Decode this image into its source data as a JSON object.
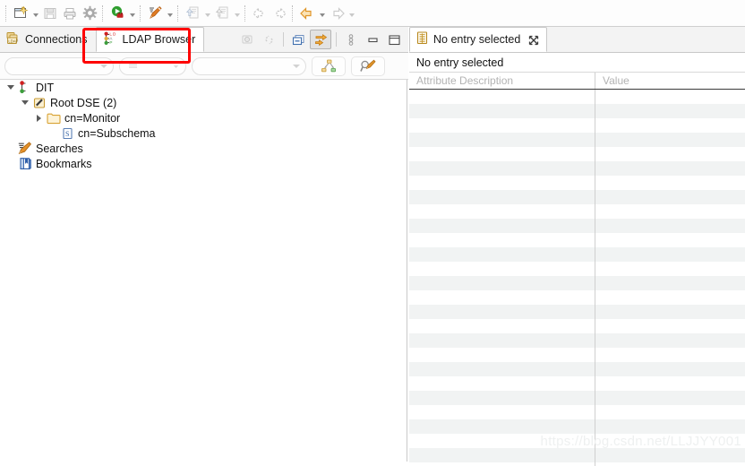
{
  "toolbar": {
    "buttons": [
      {
        "name": "new-wizard-button",
        "icon": "new-document-icon",
        "dropdown": true,
        "enabled": true
      },
      {
        "name": "save-button",
        "icon": "save-floppy-icon",
        "dropdown": false,
        "enabled": false
      },
      {
        "name": "print-button",
        "icon": "printer-icon",
        "dropdown": false,
        "enabled": false
      },
      {
        "name": "preferences-button",
        "icon": "gear-icon",
        "dropdown": false,
        "enabled": true
      },
      {
        "name": "run-connection-button",
        "icon": "green-play-icon",
        "dropdown": true,
        "enabled": true
      },
      {
        "name": "new-search-button",
        "icon": "pencil-search-icon",
        "dropdown": true,
        "enabled": true
      },
      {
        "name": "import-button",
        "icon": "import-arrow-icon",
        "dropdown": true,
        "enabled": false
      },
      {
        "name": "export-button",
        "icon": "export-arrow-icon",
        "dropdown": true,
        "enabled": false
      },
      {
        "name": "back-nav-button",
        "icon": "left-arrow-icon",
        "dropdown": false,
        "enabled": false
      },
      {
        "name": "forward-nav-button",
        "icon": "right-arrow-icon",
        "dropdown": false,
        "enabled": false
      },
      {
        "name": "history-back-button",
        "icon": "orange-left-arrow-icon",
        "dropdown": true,
        "enabled": true
      },
      {
        "name": "history-forward-button",
        "icon": "grey-right-arrow-icon",
        "dropdown": true,
        "enabled": false
      }
    ]
  },
  "left_view": {
    "tabs": [
      {
        "label": "Connections",
        "icon": "ldap-connections-icon",
        "active": false
      },
      {
        "label": "LDAP Browser",
        "icon": "ldap-browser-icon",
        "active": true
      }
    ],
    "tab_tools": [
      {
        "name": "refresh-view-button",
        "icon": "refresh-entry-icon",
        "enabled": false,
        "pressed": false
      },
      {
        "name": "link-with-editor-button",
        "icon": "link-chain-icon",
        "enabled": false,
        "pressed": false
      },
      {
        "name": "collapse-all-button",
        "icon": "collapse-all-icon",
        "enabled": true,
        "pressed": false
      },
      {
        "name": "toggle-quick-filter-button",
        "icon": "orange-double-arrow-icon",
        "enabled": true,
        "pressed": true
      },
      {
        "name": "view-menu-button",
        "icon": "vertical-dots-icon",
        "enabled": true,
        "pressed": false
      },
      {
        "name": "minimize-view-button",
        "icon": "minimize-icon",
        "enabled": true,
        "pressed": false
      },
      {
        "name": "maximize-view-button",
        "icon": "maximize-icon",
        "enabled": true,
        "pressed": false
      }
    ],
    "filter_row": {
      "attribute_combo_value": "",
      "operator_spinner_value": "",
      "value_combo_value": "",
      "buttons": [
        {
          "name": "filter-children-button",
          "icon": "node-graph-icon"
        },
        {
          "name": "quick-search-button",
          "icon": "magnifier-pencil-icon"
        }
      ]
    },
    "tree": [
      {
        "label": "DIT",
        "icon": "dit-root-icon",
        "indent": 0,
        "twisty": "open"
      },
      {
        "label": "Root DSE (2)",
        "icon": "root-dse-icon",
        "indent": 1,
        "twisty": "open"
      },
      {
        "label": "cn=Monitor",
        "icon": "folder-icon",
        "indent": 2,
        "twisty": "closed"
      },
      {
        "label": "cn=Subschema",
        "icon": "subschema-icon",
        "indent": 2,
        "twisty": "none"
      },
      {
        "label": "Searches",
        "icon": "searches-icon",
        "indent": 0,
        "twisty": "none"
      },
      {
        "label": "Bookmarks",
        "icon": "bookmarks-icon",
        "indent": 0,
        "twisty": "none"
      }
    ]
  },
  "right_view": {
    "tab": {
      "label": "No entry selected",
      "icon": "entry-editor-icon",
      "closable": true
    },
    "status_text": "No entry selected",
    "table": {
      "columns": [
        "Attribute Description",
        "Value"
      ],
      "rows": [],
      "empty_row_count": 26
    }
  },
  "annotation": {
    "name": "red-highlight-box",
    "color": "#fe0000"
  },
  "watermark": {
    "text": "https://blog.csdn.net/LLJJYY001"
  },
  "colors": {
    "accent_orange": "#e8a33d",
    "red": "#d42020",
    "green": "#3aa93a",
    "blue": "#4a79c4",
    "tab_bg": "#f3f3f3",
    "row_alt": "#f1f3f3"
  }
}
